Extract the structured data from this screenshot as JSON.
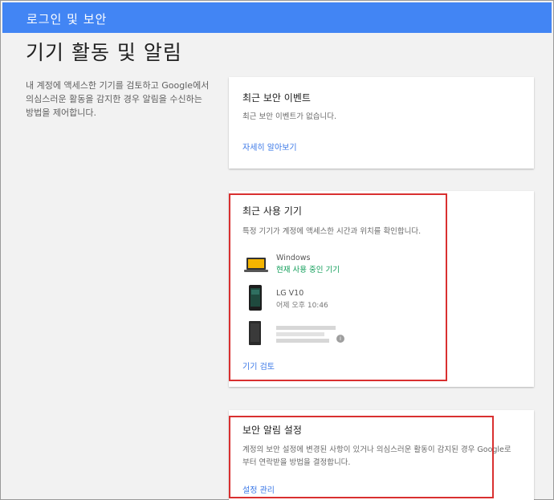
{
  "topbar": {
    "title": "로그인 및 보안"
  },
  "page": {
    "title": "기기 활동 및 알림",
    "description": "내 계정에 액세스한 기기를 검토하고 Google에서 의심스러운 활동을 감지한 경우 알림을 수신하는 방법을 제어합니다."
  },
  "security_events": {
    "title": "최근 보안 이벤트",
    "text": "최근 보안 이벤트가 없습니다.",
    "link": "자세히 알아보기"
  },
  "recent_devices": {
    "title": "최근 사용 기기",
    "text": "특정 기기가 계정에 액세스한 시간과 위치를 확인합니다.",
    "devices": [
      {
        "name": "Windows",
        "status": "현재 사용 중인 기기",
        "icon": "laptop-icon"
      },
      {
        "name": "LG V10",
        "status": "어제 오후 10:46",
        "icon": "phone-icon"
      },
      {
        "name": "",
        "status": "",
        "icon": "phone-icon"
      }
    ],
    "link": "기기 검토"
  },
  "alert_settings": {
    "title": "보안 알림 설정",
    "text": "계정의 보안 설정에 변경된 사항이 있거나 의심스러운 활동이 감지된 경우 Google로부터 연락받을 방법을 결정합니다.",
    "link": "설정 관리"
  },
  "colors": {
    "topbar": "#4285f4",
    "link": "#3b78e7",
    "current_device": "#0f9d58",
    "highlight": "#d93030"
  }
}
